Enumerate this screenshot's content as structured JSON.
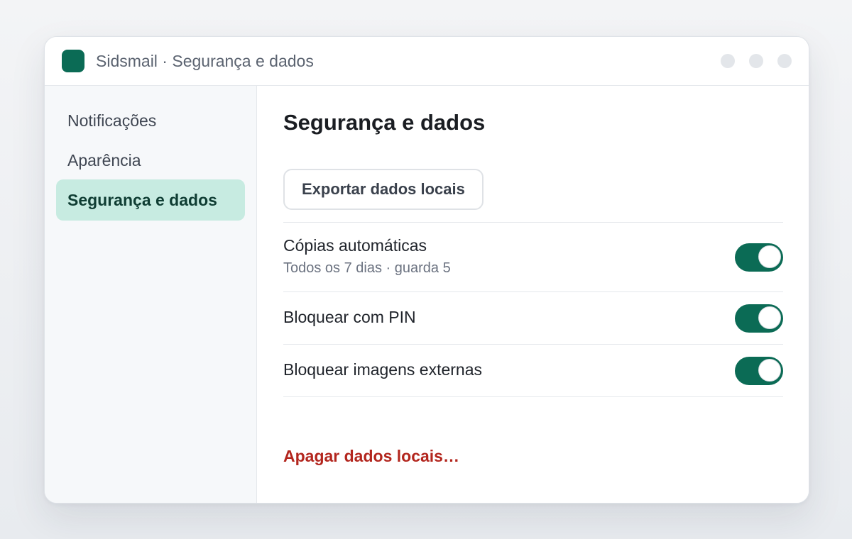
{
  "app": {
    "title": "Sidsmail · Segurança e dados",
    "icon": "app-logo-icon",
    "accent_color": "#0b6b55"
  },
  "sidebar": {
    "items": [
      {
        "label": "Notificações",
        "active": false
      },
      {
        "label": "Aparência",
        "active": false
      },
      {
        "label": "Segurança e dados",
        "active": true
      }
    ]
  },
  "main": {
    "title": "Segurança e dados",
    "export_button": "Exportar dados locais",
    "settings": [
      {
        "label": "Cópias automáticas",
        "description": "Todos os 7 dias · guarda 5",
        "enabled": true
      },
      {
        "label": "Bloquear com PIN",
        "enabled": true
      },
      {
        "label": "Bloquear imagens externas",
        "enabled": true
      }
    ],
    "danger_action": "Apagar dados locais…",
    "danger_color": "#b3261e"
  }
}
